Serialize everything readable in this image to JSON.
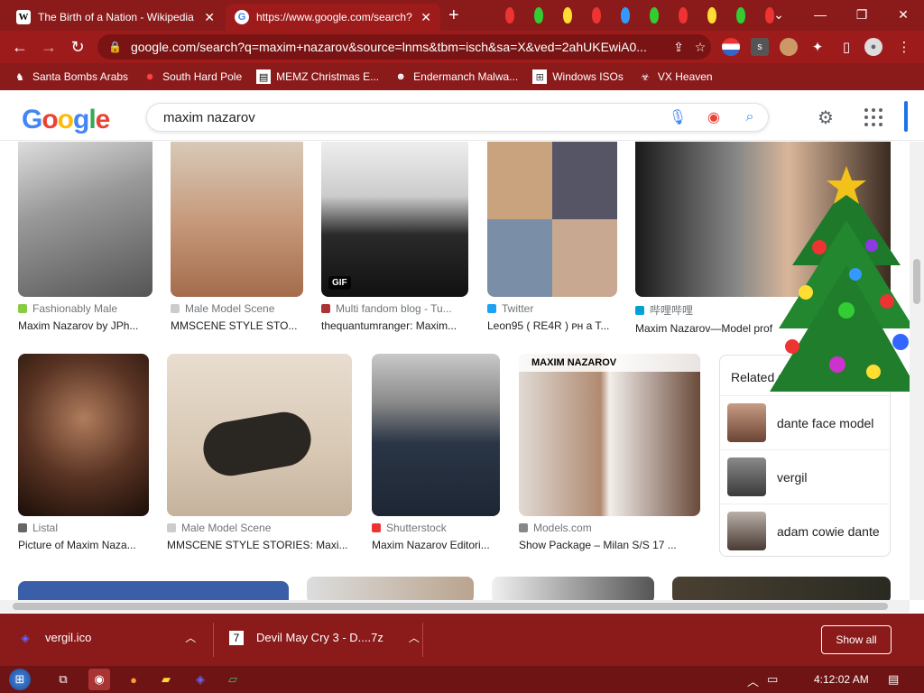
{
  "tabs": [
    {
      "title": "The Birth of a Nation - Wikipedia",
      "favicon": "W"
    },
    {
      "title": "https://www.google.com/search?",
      "favicon": "G"
    }
  ],
  "address_bar": {
    "url": "google.com/search?q=maxim+nazarov&source=lnms&tbm=isch&sa=X&ved=2ahUKEwiA0..."
  },
  "bookmarks": [
    {
      "label": "Santa Bombs Arabs",
      "icon": "santa-icon"
    },
    {
      "label": "South Hard Pole",
      "icon": "gear-icon"
    },
    {
      "label": "MEMZ Christmas E...",
      "icon": "file-icon"
    },
    {
      "label": "Endermanch Malwa...",
      "icon": "ender-icon"
    },
    {
      "label": "Windows ISOs",
      "icon": "windows-icon"
    },
    {
      "label": "VX Heaven",
      "icon": "biohazard-icon"
    }
  ],
  "search": {
    "query": "maxim nazarov",
    "logo": "Google"
  },
  "results_row1": [
    {
      "source": "Fashionably Male",
      "caption": "Maxim Nazarov by JPh..."
    },
    {
      "source": "Male Model Scene",
      "caption": "MMSCENE STYLE STO..."
    },
    {
      "source": "Multi fandom blog - Tu...",
      "caption": "thequantumranger: Maxim...",
      "badge": "GIF"
    },
    {
      "source": "Twitter",
      "caption": "Leon95 ( RE4R ) ᴘʜ a T..."
    },
    {
      "source": "哔哩哔哩",
      "caption": "Maxim Nazarov—Model prof"
    }
  ],
  "results_row2": [
    {
      "source": "Listal",
      "caption": "Picture of Maxim Naza..."
    },
    {
      "source": "Male Model Scene",
      "caption": "MMSCENE STYLE STORIES: Maxi..."
    },
    {
      "source": "Shutterstock",
      "caption": "Maxim Nazarov Editori..."
    },
    {
      "source": "Models.com",
      "caption": "Show Package – Milan S/S 17 ...",
      "overlay": "MAXIM NAZAROV"
    }
  ],
  "related": {
    "title": "Related se",
    "items": [
      {
        "label": "dante face model"
      },
      {
        "label": "vergil"
      },
      {
        "label": "adam cowie dante"
      }
    ]
  },
  "downloads": [
    {
      "filename": "vergil.ico"
    },
    {
      "filename": "Devil May Cry 3 - D....7z"
    }
  ],
  "show_all": "Show all",
  "clock": "4:12:02 AM",
  "colors": {
    "chrome": "#8b1a1a",
    "accent": "#1a73e8"
  }
}
